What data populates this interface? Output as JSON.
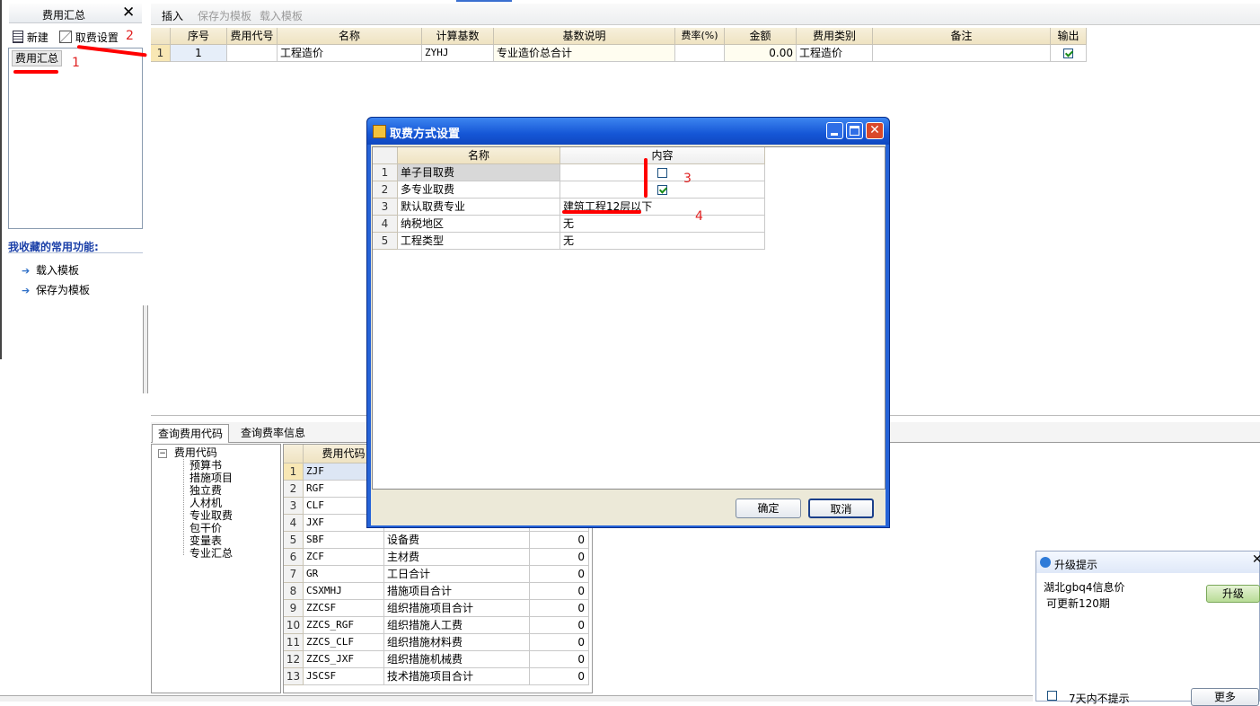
{
  "left_panel": {
    "title": "费用汇总",
    "new_label": "新建",
    "fee_setting_label": "取费设置",
    "tree_item": "费用汇总",
    "favorites_title": "我收藏的常用功能:",
    "favorites": [
      "载入模板",
      "保存为模板"
    ]
  },
  "toolbar": {
    "insert": "插入",
    "save_template": "保存为模板",
    "load_template": "载入模板"
  },
  "main_grid": {
    "columns": [
      "序号",
      "费用代号",
      "名称",
      "计算基数",
      "基数说明",
      "费率(%)",
      "金额",
      "费用类别",
      "备注",
      "输出"
    ],
    "row": {
      "num": "1",
      "seq": "1",
      "code": "",
      "name": "工程造价",
      "base": "ZYHJ",
      "base_desc": "专业造价总合计",
      "rate": "",
      "amount": "0.00",
      "category": "工程造价",
      "note": ""
    }
  },
  "bottom_tabs": [
    "查询费用代码",
    "查询费率信息"
  ],
  "tree": {
    "root": "费用代码",
    "children": [
      "预算书",
      "措施项目",
      "独立费",
      "人材机",
      "专业取费",
      "包干价",
      "变量表",
      "专业汇总"
    ]
  },
  "code_grid": {
    "header": "费用代码",
    "rows": [
      {
        "n": "1",
        "code": "ZJF",
        "name": "",
        "val": ""
      },
      {
        "n": "2",
        "code": "RGF",
        "name": "",
        "val": ""
      },
      {
        "n": "3",
        "code": "CLF",
        "name": "",
        "val": ""
      },
      {
        "n": "4",
        "code": "JXF",
        "name": "",
        "val": ""
      },
      {
        "n": "5",
        "code": "SBF",
        "name": "设备费",
        "val": "0"
      },
      {
        "n": "6",
        "code": "ZCF",
        "name": "主材费",
        "val": "0"
      },
      {
        "n": "7",
        "code": "GR",
        "name": "工日合计",
        "val": "0"
      },
      {
        "n": "8",
        "code": "CSXMHJ",
        "name": "措施项目合计",
        "val": "0"
      },
      {
        "n": "9",
        "code": "ZZCSF",
        "name": "组织措施项目合计",
        "val": "0"
      },
      {
        "n": "10",
        "code": "ZZCS_RGF",
        "name": "组织措施人工费",
        "val": "0"
      },
      {
        "n": "11",
        "code": "ZZCS_CLF",
        "name": "组织措施材料费",
        "val": "0"
      },
      {
        "n": "12",
        "code": "ZZCS_JXF",
        "name": "组织措施机械费",
        "val": "0"
      },
      {
        "n": "13",
        "code": "JSCSF",
        "name": "技术措施项目合计",
        "val": "0"
      }
    ]
  },
  "dialog": {
    "title": "取费方式设置",
    "col_name": "名称",
    "col_content": "内容",
    "rows": [
      {
        "n": "1",
        "name": "单子目取费",
        "content": "",
        "checked": false,
        "type": "check"
      },
      {
        "n": "2",
        "name": "多专业取费",
        "content": "",
        "checked": true,
        "type": "check"
      },
      {
        "n": "3",
        "name": "默认取费专业",
        "content": "建筑工程12层以下",
        "type": "text"
      },
      {
        "n": "4",
        "name": "纳税地区",
        "content": "无",
        "type": "text"
      },
      {
        "n": "5",
        "name": "工程类型",
        "content": "无",
        "type": "text"
      }
    ],
    "ok": "确定",
    "cancel": "取消"
  },
  "annotations": [
    "1",
    "2",
    "3",
    "4"
  ],
  "upgrade_popup": {
    "title": "升级提示",
    "line1": "湖北gbq4信息价",
    "line2": "可更新120期",
    "upgrade_button": "升级",
    "dont_show": "7天内不提示",
    "more_button": "更多"
  }
}
